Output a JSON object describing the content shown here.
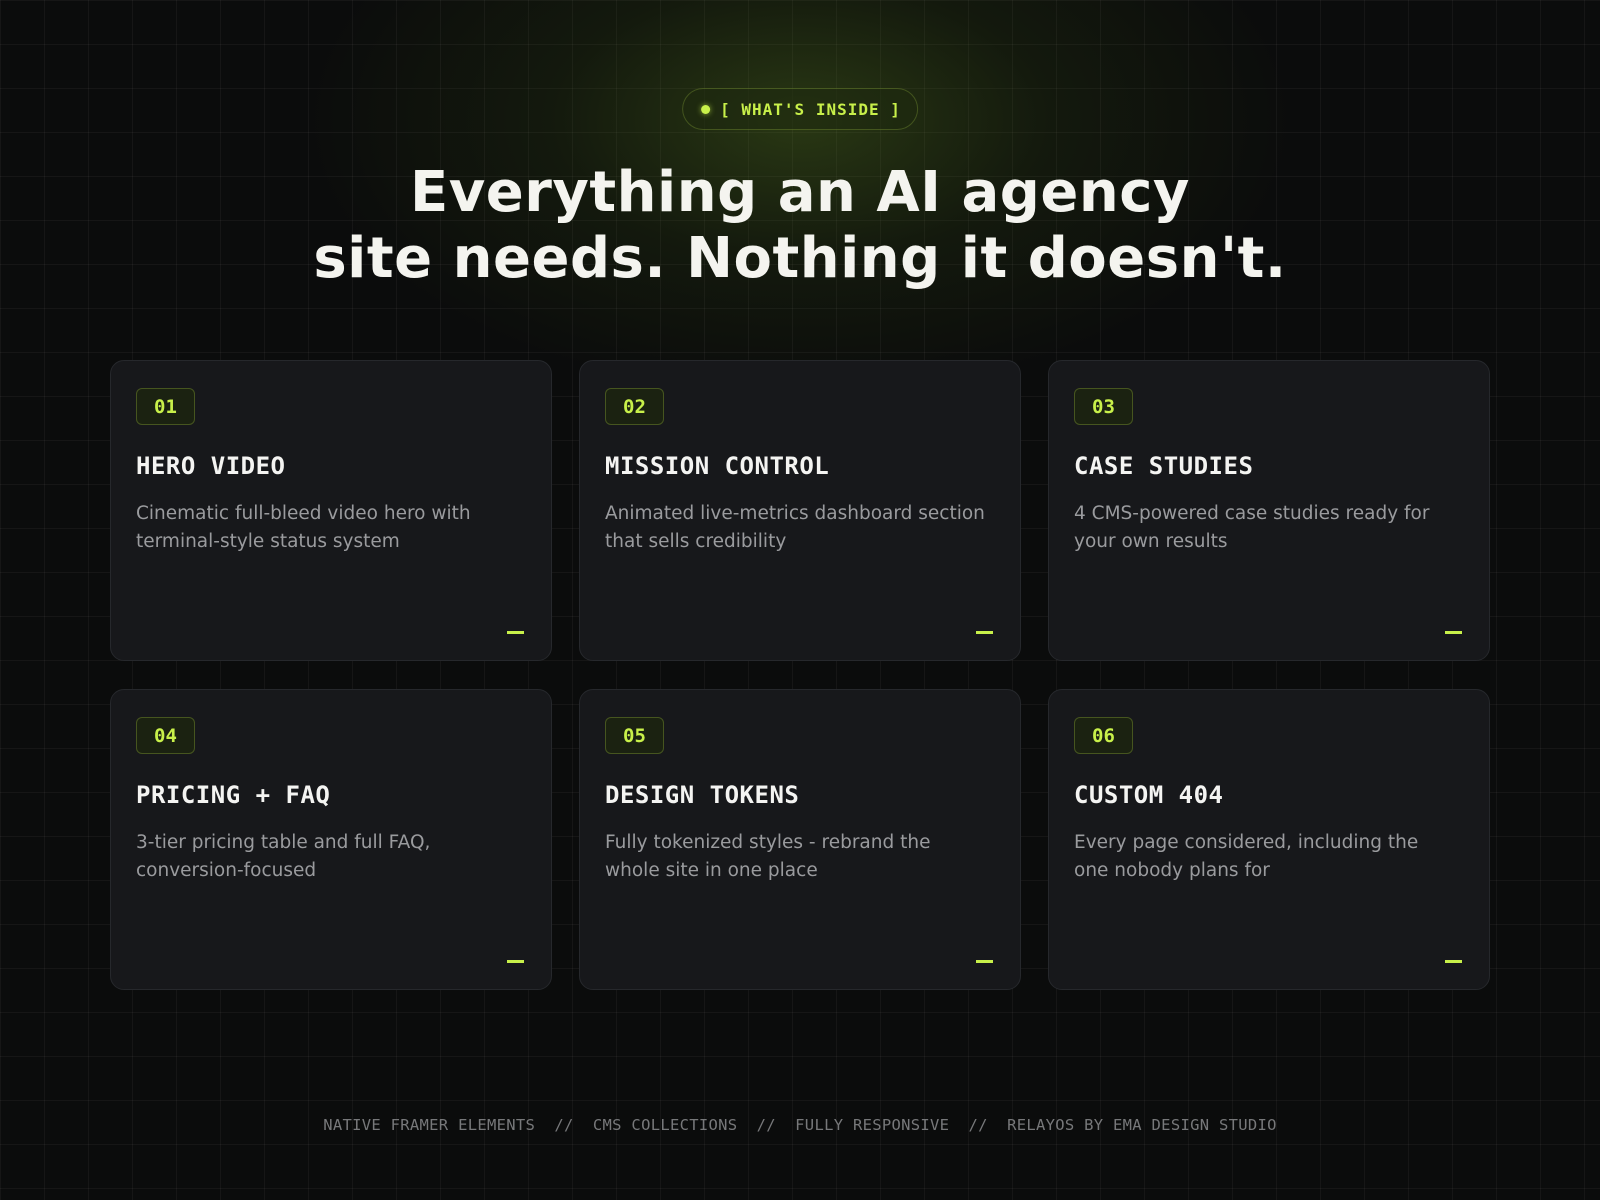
{
  "badge": {
    "label": "[ WHAT'S INSIDE ]"
  },
  "headline": {
    "line1": "Everything an AI agency",
    "line2": "site needs. Nothing it doesn't."
  },
  "cards": [
    {
      "number": "01",
      "title": "HERO VIDEO",
      "description": "Cinematic full-bleed video hero with terminal-style status system"
    },
    {
      "number": "02",
      "title": "MISSION CONTROL",
      "description": "Animated live-metrics dashboard section that sells credibility"
    },
    {
      "number": "03",
      "title": "CASE STUDIES",
      "description": "4 CMS-powered case studies ready for your own results"
    },
    {
      "number": "04",
      "title": "PRICING + FAQ",
      "description": "3-tier pricing table and full FAQ, conversion-focused"
    },
    {
      "number": "05",
      "title": "DESIGN TOKENS",
      "description": "Fully tokenized styles - rebrand the whole site in one place"
    },
    {
      "number": "06",
      "title": "CUSTOM 404",
      "description": "Every page considered, including the one nobody plans for"
    }
  ],
  "footer": {
    "text": "NATIVE FRAMER ELEMENTS  //  CMS COLLECTIONS  //  FULLY RESPONSIVE  //  RELAYOS BY EMA DESIGN STUDIO"
  },
  "colors": {
    "accent": "#c8f04a",
    "background": "#0b0c0c",
    "card": "#17181b"
  }
}
